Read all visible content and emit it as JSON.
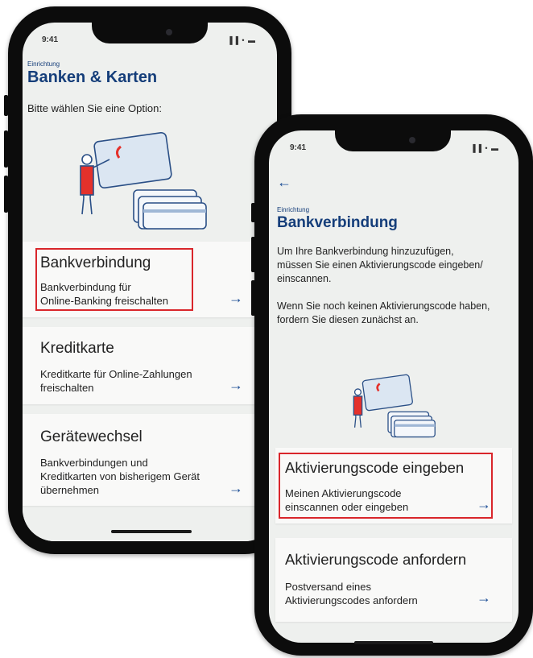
{
  "phone1": {
    "status_time": "9:41",
    "status_icons": "▐▐ • ▬",
    "overline": "Einrichtung",
    "title": "Banken & Karten",
    "prompt": "Bitte wählen Sie eine Option:",
    "illustration": "card-illustration",
    "cards": [
      {
        "title": "Bankverbindung",
        "subtitle": [
          "Bankverbindung für",
          "Online-Banking freischalten"
        ],
        "arrow_icon": "arrow-right-icon",
        "highlighted": true
      },
      {
        "title": "Kreditkarte",
        "subtitle": [
          "Kreditkarte für Online-Zahlungen",
          "freischalten"
        ],
        "arrow_icon": "arrow-right-icon",
        "highlighted": false
      },
      {
        "title": "Gerätewechsel",
        "subtitle": [
          "Bankverbindungen und",
          "Kreditkarten von bisherigem Gerät",
          "übernehmen"
        ],
        "arrow_icon": "arrow-right-icon",
        "highlighted": false
      }
    ]
  },
  "phone2": {
    "status_time": "9:41",
    "status_icons": "▐▐ • ▬",
    "back_icon": "arrow-left-icon",
    "overline": "Einrichtung",
    "title": "Bankverbindung",
    "para1": [
      "Um Ihre Bankverbindung hinzuzufügen,",
      "müssen Sie einen Aktivierungscode eingeben/",
      "einscannen."
    ],
    "para2": [
      "Wenn Sie noch keinen Aktivierungscode haben,",
      "fordern Sie diesen zunächst an."
    ],
    "illustration": "card-illustration",
    "cards": [
      {
        "title": "Aktivierungscode eingeben",
        "subtitle": [
          "Meinen Aktivierungscode",
          "einscannen oder eingeben"
        ],
        "arrow_icon": "arrow-right-icon",
        "highlighted": true
      },
      {
        "title": "Aktivierungscode anfordern",
        "subtitle": [
          "Postversand eines",
          "Aktivierungscodes anfordern"
        ],
        "arrow_icon": "arrow-right-icon",
        "highlighted": false
      }
    ]
  },
  "colors": {
    "accent": "#153e7a",
    "arrow": "#1b4d95",
    "highlight": "#d9262b",
    "card_red": "#e4312b"
  },
  "arrow_glyph": "→",
  "back_glyph": "←"
}
